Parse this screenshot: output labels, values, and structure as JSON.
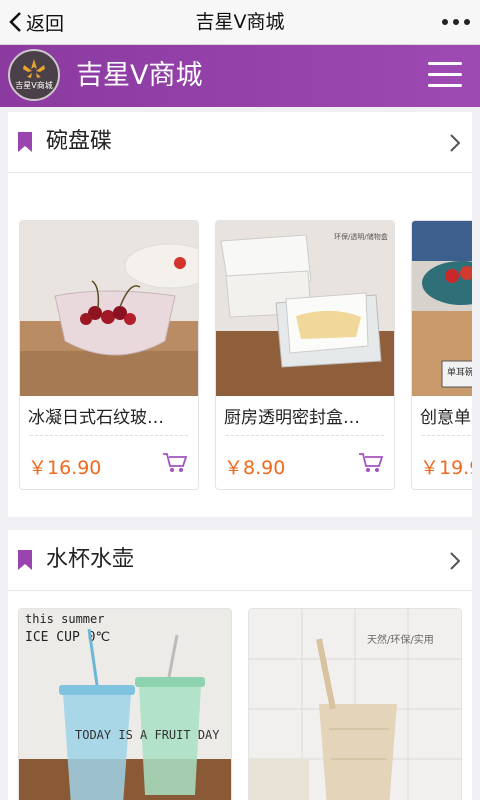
{
  "topbar": {
    "back_label": "返回",
    "title": "吉星V商城"
  },
  "header": {
    "brand": "吉星V商城",
    "logo_text": "吉星V商城"
  },
  "sections": [
    {
      "title": "碗盘碟",
      "products": [
        {
          "name": "冰凝日式石纹玻…",
          "price": "￥16.90"
        },
        {
          "name": "厨房透明密封盒…",
          "price": "￥8.90"
        },
        {
          "name": "创意单",
          "price": "￥19.9"
        }
      ],
      "image_texts": {
        "box_tag": "环保/透明/储物盒",
        "bowl_tag": "单耳碗"
      }
    },
    {
      "title": "水杯水壶",
      "image_texts": {
        "cup_line1": "this summer",
        "cup_line2": "ICE CUP 0℃",
        "cup_print": "TODAY IS A FRUIT DAY",
        "cup2_line1": "天然/环保/实用"
      }
    }
  ],
  "colors": {
    "accent": "#9a44b0",
    "price": "#f06a1e"
  }
}
